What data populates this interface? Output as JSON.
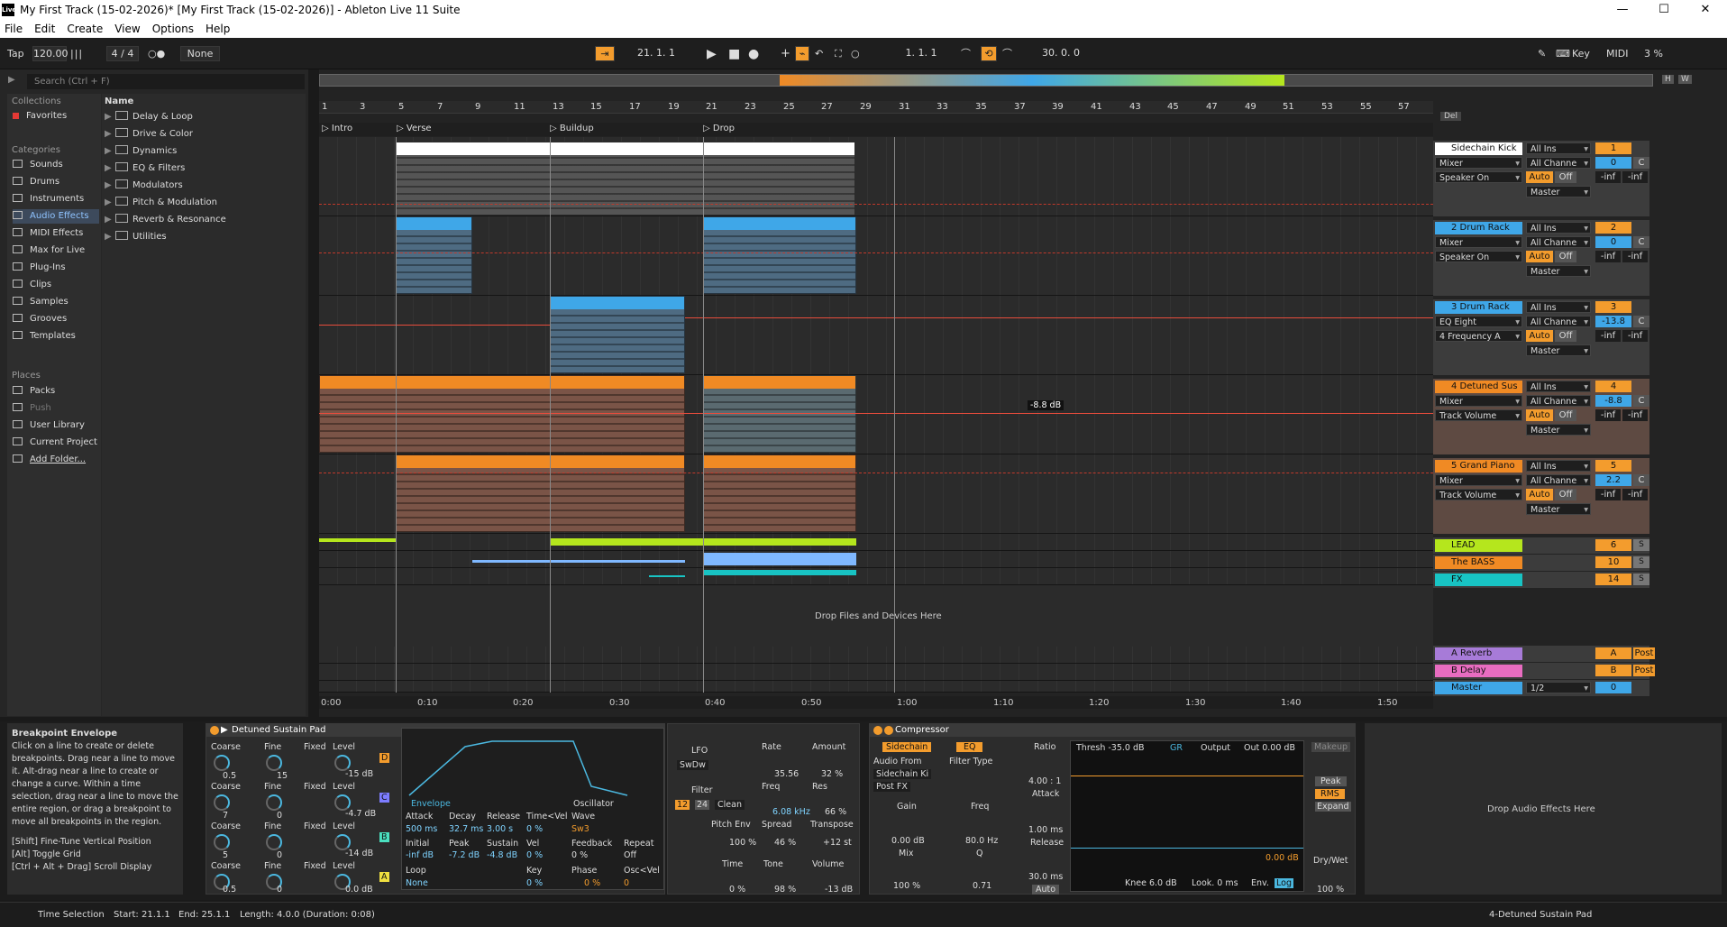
{
  "window": {
    "title": "My First Track (15-02-2026)*  [My First Track (15-02-2026)] - Ableton Live 11 Suite",
    "logo": "Live"
  },
  "menu": [
    "File",
    "Edit",
    "Create",
    "View",
    "Options",
    "Help"
  ],
  "transport": {
    "tap": "Tap",
    "tempo": "120.00",
    "meter": "4 / 4",
    "quant": "None",
    "position": "21.  1.  1",
    "loop_start": "1.  1.  1",
    "loop_length": "30.  0.  0",
    "key": "Key",
    "midi": "MIDI",
    "cpu": "3 %"
  },
  "browser": {
    "search_placeholder": "Search (Ctrl + F)",
    "collections_header": "Collections",
    "favorites": "Favorites",
    "categories_header": "Categories",
    "categories": [
      "Sounds",
      "Drums",
      "Instruments",
      "Audio Effects",
      "MIDI Effects",
      "Max for Live",
      "Plug-Ins",
      "Clips",
      "Samples",
      "Grooves",
      "Templates"
    ],
    "places_header": "Places",
    "places": [
      "Packs",
      "Push",
      "User Library",
      "Current Project",
      "Add Folder..."
    ],
    "name_header": "Name",
    "items": [
      "Delay & Loop",
      "Drive & Color",
      "Dynamics",
      "EQ & Filters",
      "Modulators",
      "Pitch & Modulation",
      "Reverb & Resonance",
      "Utilities"
    ]
  },
  "ruler": [
    "1",
    "3",
    "5",
    "7",
    "9",
    "11",
    "13",
    "15",
    "17",
    "19",
    "21",
    "23",
    "25",
    "27",
    "29",
    "31",
    "33",
    "35",
    "37",
    "39",
    "41",
    "43",
    "45",
    "47",
    "49",
    "51",
    "53",
    "55",
    "57"
  ],
  "locators": [
    "Intro",
    "Verse",
    "Buildup",
    "Drop"
  ],
  "drop_hint": "Drop Files and Devices Here",
  "env_value": "-8.8 dB",
  "timeline": [
    "0:00",
    "0:10",
    "0:20",
    "0:30",
    "0:40",
    "0:50",
    "1:00",
    "1:10",
    "1:20",
    "1:30",
    "1:40",
    "1:50"
  ],
  "mixer": {
    "del": "Del",
    "tracks": [
      {
        "name": "Sidechain Kick",
        "color": "#ffffff",
        "in": "All Ins",
        "ch": "All Channe",
        "mon1": "Mixer",
        "mon2": "Speaker On",
        "auto": "Auto",
        "off": "Off",
        "out": "Master",
        "num": "1",
        "vol": "0",
        "pan": "C",
        "inf1": "-inf",
        "inf2": "-inf"
      },
      {
        "name": "2 Drum Rack",
        "color": "#3fa7e8",
        "in": "All Ins",
        "ch": "All Channe",
        "mon1": "Mixer",
        "mon2": "Speaker On",
        "auto": "Auto",
        "off": "Off",
        "out": "Master",
        "num": "2",
        "vol": "0",
        "pan": "C",
        "inf1": "-inf",
        "inf2": "-inf"
      },
      {
        "name": "3 Drum Rack",
        "color": "#3fa7e8",
        "in": "All Ins",
        "ch": "All Channe",
        "mon1": "EQ Eight",
        "mon2": "4 Frequency A",
        "auto": "Auto",
        "off": "Off",
        "out": "Master",
        "num": "3",
        "vol": "-13.8",
        "pan": "C",
        "inf1": "-inf",
        "inf2": "-inf"
      },
      {
        "name": "4 Detuned Sus",
        "color": "#f08a24",
        "in": "All Ins",
        "ch": "All Channe",
        "mon1": "Mixer",
        "mon2": "Track Volume",
        "auto": "Auto",
        "off": "Off",
        "out": "Master",
        "num": "4",
        "vol": "-8.8",
        "pan": "C",
        "inf1": "-inf",
        "inf2": "-inf"
      },
      {
        "name": "5 Grand Piano",
        "color": "#f08a24",
        "in": "All Ins",
        "ch": "All Channe",
        "mon1": "Mixer",
        "mon2": "Track Volume",
        "auto": "Auto",
        "off": "Off",
        "out": "Master",
        "num": "5",
        "vol": "2.2",
        "pan": "C",
        "inf1": "-inf",
        "inf2": "-inf"
      }
    ],
    "groups": [
      {
        "name": "LEAD",
        "num": "6",
        "color": "#b5e61d"
      },
      {
        "name": "The BASS",
        "num": "10",
        "color": "#f08a24"
      },
      {
        "name": "FX",
        "num": "14",
        "color": "#18c4c4"
      }
    ],
    "returns": [
      {
        "name": "A Reverb",
        "num": "A",
        "color": "#a77bd8",
        "post": "Post"
      },
      {
        "name": "B Delay",
        "num": "B",
        "color": "#e86cc0",
        "post": "Post"
      },
      {
        "name": "Master",
        "num": "0",
        "color": "#3fa7e8",
        "post": "1/2"
      }
    ],
    "s": "S"
  },
  "info": {
    "title": "Breakpoint Envelope",
    "body": "Click on a line to create or delete breakpoints. Drag near a line to move it. Alt-drag near a line to create or change a curve. Within a time selection, drag near a line to move the entire region, or drag a breakpoint to move all breakpoints in the region.",
    "k1": "[Shift] Fine-Tune Vertical Position",
    "k2": "[Alt] Toggle Grid",
    "k3": "[Ctrl + Alt + Drag] Scroll Display"
  },
  "synth": {
    "name": "Detuned Sustain Pad",
    "osc": [
      {
        "coarse": "0.5",
        "fine": "15",
        "level": "-15 dB",
        "letter": "D"
      },
      {
        "coarse": "7",
        "fine": "0",
        "level": "-4.7 dB",
        "letter": "C"
      },
      {
        "coarse": "5",
        "fine": "0",
        "level": "-14 dB",
        "letter": "B"
      },
      {
        "coarse": "0.5",
        "fine": "0",
        "level": "0.0 dB",
        "letter": "A"
      }
    ],
    "lbl": {
      "coarse": "Coarse",
      "fine": "Fine",
      "fixed": "Fixed",
      "level": "Level"
    },
    "env": {
      "tab": "Envelope",
      "osc_tab": "Oscillator",
      "attack": "Attack",
      "decay": "Decay",
      "release": "Release",
      "timevel": "Time<Vel",
      "wave": "Wave",
      "a": "500 ms",
      "d": "32.7 ms",
      "r": "3.00 s",
      "tv": "0 %",
      "w": "Sw3",
      "initial": "Initial",
      "peak": "Peak",
      "sustain": "Sustain",
      "vel": "Vel",
      "feedback": "Feedback",
      "repeat": "Repeat",
      "i": "-inf dB",
      "p": "-7.2 dB",
      "s": "-4.8 dB",
      "v": "0 %",
      "fb": "0 %",
      "rp": "Off",
      "loop": "Loop",
      "key": "Key",
      "phase": "Phase",
      "oscvel": "Osc<Vel",
      "lp": "None",
      "k": "0 %",
      "ph": "0 %",
      "ov": "0"
    },
    "lfo": {
      "label": "LFO",
      "shape": "SwDw",
      "rate": "Rate",
      "amount": "Amount",
      "rv": "35.56",
      "av": "32 %"
    },
    "filter": {
      "label": "Filter",
      "freq": "Freq",
      "res": "Res",
      "fv": "6.08 kHz",
      "rs": "66 %",
      "b1": "12",
      "b2": "24",
      "mode": "Clean",
      "pitchenv": "Pitch Env",
      "spread": "Spread",
      "transpose": "Transpose",
      "pe": "100 %",
      "sp": "46 %",
      "tr": "+12 st",
      "time": "Time",
      "tone": "Tone",
      "volume": "Volume",
      "tm": "0 %",
      "tn": "98 %",
      "vo": "-13 dB"
    }
  },
  "comp": {
    "name": "Compressor",
    "sidechain": "Sidechain",
    "eq": "EQ",
    "audiofrom": "Audio From",
    "src": "Sidechain Ki",
    "post": "Post FX",
    "filtertype": "Filter Type",
    "gain": "Gain",
    "gv": "0.00 dB",
    "mix": "Mix",
    "mv": "100 %",
    "freq": "Freq",
    "frv": "80.0 Hz",
    "q": "Q",
    "qv": "0.71",
    "ratio": "Ratio",
    "rv": "4.00 : 1",
    "attack": "Attack",
    "atv": "1.00 ms",
    "release": "Release",
    "rel": "30.0 ms",
    "auto": "Auto",
    "thresh": "Thresh -35.0 dB",
    "gr": "GR",
    "output": "Output",
    "out": "Out 0.00 dB",
    "makeup": "Makeup",
    "peak": "Peak",
    "rms": "RMS",
    "expand": "Expand",
    "knee": "Knee 6.0 dB",
    "look": "Look. 0 ms",
    "env": "Env.",
    "log": "Log",
    "drywet": "Dry/Wet",
    "dwv": "100 %",
    "gdb": "0.00 dB"
  },
  "drop_fx": "Drop Audio Effects Here",
  "status": {
    "sel": "Time Selection",
    "start": "Start: 21.1.1",
    "end": "End: 25.1.1",
    "len": "Length: 4.0.0 (Duration: 0:08)",
    "track": "4-Detuned Sustain Pad"
  }
}
